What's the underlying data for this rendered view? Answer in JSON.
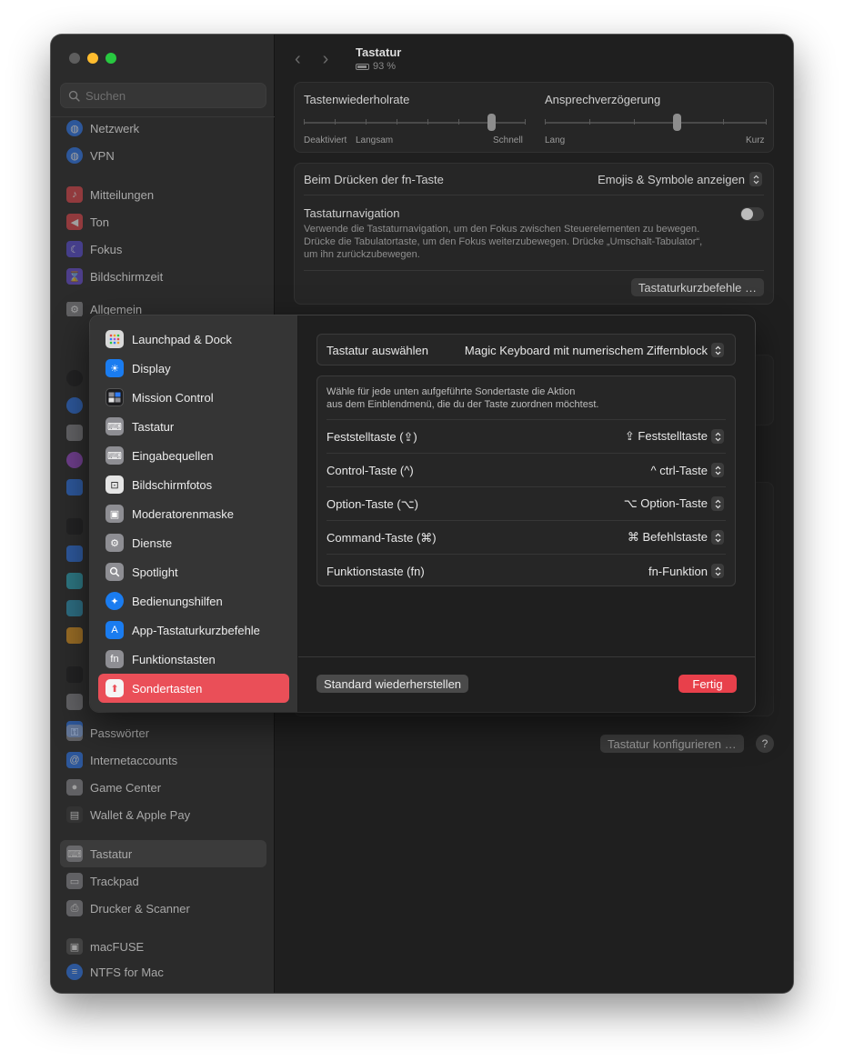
{
  "sidebar": {
    "search_placeholder": "Suchen",
    "items": [
      {
        "label": "Netzwerk",
        "icon": "globe-icon",
        "color": "#2f7cf6"
      },
      {
        "label": "VPN",
        "icon": "globe-icon",
        "color": "#2f7cf6"
      },
      {
        "label": "Mitteilungen",
        "icon": "bell-icon",
        "color": "#e5484d"
      },
      {
        "label": "Ton",
        "icon": "speaker-icon",
        "color": "#e5484d"
      },
      {
        "label": "Fokus",
        "icon": "moon-icon",
        "color": "#5b4fd9"
      },
      {
        "label": "Bildschirmzeit",
        "icon": "hourglass-icon",
        "color": "#6a4fd9"
      },
      {
        "label": "Allgemein",
        "icon": "gear-icon",
        "color": "#8e8e93"
      },
      {
        "label": "Passwörter",
        "icon": "key-icon",
        "color": "#8e8e93"
      },
      {
        "label": "Internetaccounts",
        "icon": "at-icon",
        "color": "#2f7cf6"
      },
      {
        "label": "Game Center",
        "icon": "gamecenter-icon",
        "color": "#8e8e93"
      },
      {
        "label": "Wallet & Apple Pay",
        "icon": "wallet-icon",
        "color": "#3a3a3a"
      },
      {
        "label": "Tastatur",
        "icon": "keyboard-icon",
        "color": "#8e8e93"
      },
      {
        "label": "Trackpad",
        "icon": "trackpad-icon",
        "color": "#8e8e93"
      },
      {
        "label": "Drucker & Scanner",
        "icon": "printer-icon",
        "color": "#8e8e93"
      },
      {
        "label": "macFUSE",
        "icon": "macfuse-icon",
        "color": "#555555"
      },
      {
        "label": "NTFS for Mac",
        "icon": "ntfs-icon",
        "color": "#2f7cf6"
      }
    ]
  },
  "main": {
    "title": "Tastatur",
    "battery": "93 %",
    "key_repeat": {
      "label": "Tastenwiederholrate",
      "left_a": "Deaktiviert",
      "left_b": "Langsam",
      "right": "Schnell"
    },
    "delay": {
      "label": "Ansprechverzögerung",
      "left": "Lang",
      "right": "Kurz"
    },
    "fn_label": "Beim Drücken der fn-Taste",
    "fn_value": "Emojis & Symbole anzeigen",
    "nav_title": "Tastaturnavigation",
    "nav_desc_1": "Verwende die Tastaturnavigation, um den Fokus zwischen Steuerelementen zu bewegen.",
    "nav_desc_2": "Drücke die Tabulatortaste, um den Fokus weiterzubewegen. Drücke „Umschalt-Tabulator“,",
    "nav_desc_3": "um ihn zurückzubewegen.",
    "shortcuts_button": "Tastaturkurzbefehle …",
    "configure_button": "Tastatur konfigurieren …",
    "help": "?"
  },
  "sheet": {
    "categories": [
      {
        "label": "Launchpad & Dock",
        "icon": "launchpad-icon",
        "color": "#d9d9d9"
      },
      {
        "label": "Display",
        "icon": "sun-icon",
        "color": "#1a7cf0"
      },
      {
        "label": "Mission Control",
        "icon": "mission-control-icon",
        "color": "#1c1c1e"
      },
      {
        "label": "Tastatur",
        "icon": "keyboard-icon",
        "color": "#8e8e93"
      },
      {
        "label": "Eingabequellen",
        "icon": "keyboard-icon",
        "color": "#8e8e93"
      },
      {
        "label": "Bildschirmfotos",
        "icon": "screenshot-icon",
        "color": "#e5e5e5"
      },
      {
        "label": "Moderatorenmaske",
        "icon": "presenter-icon",
        "color": "#8e8e93"
      },
      {
        "label": "Dienste",
        "icon": "gears-icon",
        "color": "#8e8e93"
      },
      {
        "label": "Spotlight",
        "icon": "magnifier-icon",
        "color": "#8e8e93"
      },
      {
        "label": "Bedienungshilfen",
        "icon": "accessibility-icon",
        "color": "#1a7cf0"
      },
      {
        "label": "App-Tastaturkurzbefehle",
        "icon": "appstore-icon",
        "color": "#1a7cf0"
      },
      {
        "label": "Funktionstasten",
        "icon": "fn-icon",
        "color": "#8e8e93"
      },
      {
        "label": "Sondertasten",
        "icon": "arrow-up-icon",
        "color": "#f5f5f5"
      }
    ],
    "fn_glyph": "fn",
    "keyboard_select_label": "Tastatur auswählen",
    "keyboard_select_value": "Magic Keyboard mit numerischem Ziffernblock",
    "desc_1": "Wähle für jede unten aufgeführte Sondertaste die Aktion",
    "desc_2": "aus dem Einblendmenü, die du der Taste zuordnen möchtest.",
    "rows": [
      {
        "label": "Feststelltaste (⇪)",
        "value": "⇪ Feststelltaste"
      },
      {
        "label": "Control-Taste (^)",
        "value": "^ ctrl-Taste"
      },
      {
        "label": "Option-Taste (⌥)",
        "value": "⌥ Option-Taste"
      },
      {
        "label": "Command-Taste (⌘)",
        "value": "⌘ Befehlstaste"
      },
      {
        "label": "Funktionstaste (fn)",
        "value": "fn-Funktion"
      }
    ],
    "restore_button": "Standard wiederherstellen",
    "done_button": "Fertig",
    "accent": "#e8404b"
  }
}
